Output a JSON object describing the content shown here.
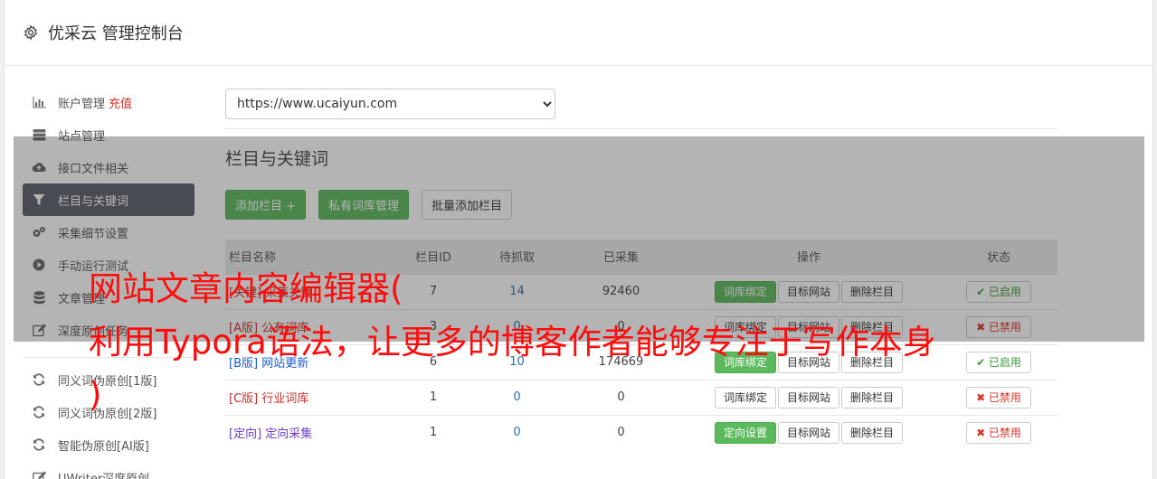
{
  "header": {
    "title": "优采云 管理控制台",
    "icon": "gear-icon"
  },
  "sidebar": {
    "items": [
      {
        "label": "账户管理",
        "extra": "充值",
        "icon": "bar-chart-icon"
      },
      {
        "label": "站点管理",
        "icon": "server-icon"
      },
      {
        "label": "接口文件相关",
        "icon": "cloud-upload-icon"
      },
      {
        "label": "栏目与关键词",
        "icon": "filter-icon",
        "active": true
      },
      {
        "label": "采集细节设置",
        "icon": "cogs-icon"
      },
      {
        "label": "手动运行测试",
        "icon": "play-circle-icon"
      },
      {
        "label": "文章管理",
        "icon": "database-icon"
      },
      {
        "label": "深度原创任务",
        "icon": "edit-icon"
      }
    ],
    "items2": [
      {
        "label": "同义词伪原创[1版]",
        "icon": "refresh-icon"
      },
      {
        "label": "同义词伪原创[2版]",
        "icon": "refresh-icon"
      },
      {
        "label": "智能伪原创[AI版]",
        "icon": "refresh-icon"
      },
      {
        "label": "UWriter深度原创",
        "icon": "edit-icon"
      }
    ]
  },
  "main": {
    "site_select": "https://www.ucaiyun.com",
    "section_title": "栏目与关键词",
    "buttons": {
      "add_column": "添加栏目 +",
      "private_lib": "私有词库管理",
      "batch_add": "批量添加栏目"
    },
    "table": {
      "headers": [
        "栏目名称",
        "栏目ID",
        "待抓取",
        "已采集",
        "操作",
        "状态"
      ],
      "rows": [
        {
          "prefix": "[关键]",
          "name": "采集关键",
          "id": "7",
          "pending": "14",
          "collected": "92460",
          "op1": "词库绑定",
          "op1_green": true,
          "op2": "目标网站",
          "op3": "删除栏目",
          "status": "已启用",
          "on": true
        },
        {
          "prefix": "[A版]",
          "name": "公有词库",
          "id": "3",
          "pending": "0",
          "collected": "0",
          "op1": "词库绑定",
          "op1_green": false,
          "op2": "目标网站",
          "op3": "删除栏目",
          "status": "已禁用",
          "on": false
        },
        {
          "prefix": "[B版]",
          "name": "网站更新",
          "id": "6",
          "pending": "10",
          "collected": "174669",
          "op1": "词库绑定",
          "op1_green": true,
          "op2": "目标网站",
          "op3": "删除栏目",
          "status": "已启用",
          "on": true
        },
        {
          "prefix": "[C版]",
          "name": "行业词库",
          "id": "1",
          "pending": "0",
          "collected": "0",
          "op1": "词库绑定",
          "op1_green": false,
          "op2": "目标网站",
          "op3": "删除栏目",
          "status": "已禁用",
          "on": false
        },
        {
          "prefix": "[定向]",
          "name": "定向采集",
          "id": "1",
          "pending": "0",
          "collected": "0",
          "op1": "定向设置",
          "op1_green": true,
          "op2": "目标网站",
          "op3": "删除栏目",
          "status": "已禁用",
          "on": false
        }
      ]
    }
  },
  "watermark": {
    "line1": "网站文章内容编辑器(",
    "line2": "利用Typora语法，让更多的博客作者能够专注于写作本身",
    "line3": ")"
  }
}
